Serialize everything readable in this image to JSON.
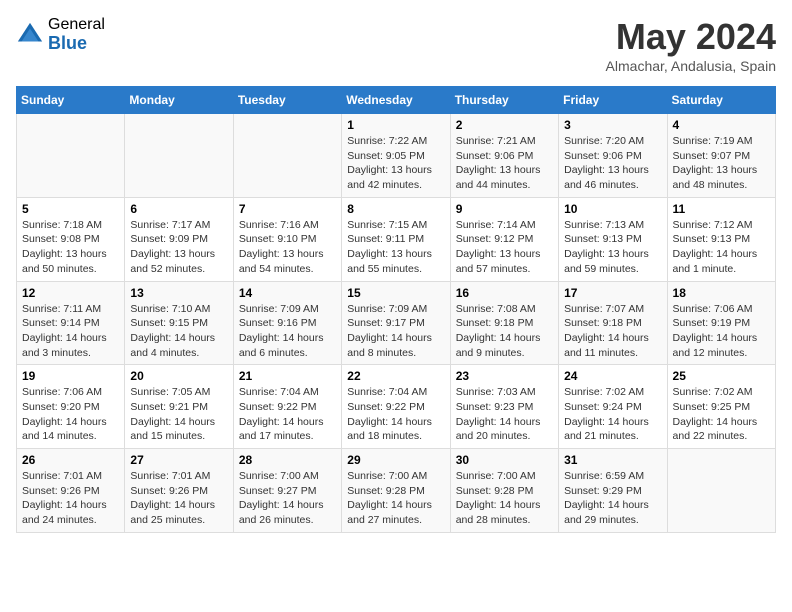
{
  "header": {
    "logo_general": "General",
    "logo_blue": "Blue",
    "month_title": "May 2024",
    "location": "Almachar, Andalusia, Spain"
  },
  "weekdays": [
    "Sunday",
    "Monday",
    "Tuesday",
    "Wednesday",
    "Thursday",
    "Friday",
    "Saturday"
  ],
  "weeks": [
    [
      {
        "day": "",
        "info": ""
      },
      {
        "day": "",
        "info": ""
      },
      {
        "day": "",
        "info": ""
      },
      {
        "day": "1",
        "info": "Sunrise: 7:22 AM\nSunset: 9:05 PM\nDaylight: 13 hours\nand 42 minutes."
      },
      {
        "day": "2",
        "info": "Sunrise: 7:21 AM\nSunset: 9:06 PM\nDaylight: 13 hours\nand 44 minutes."
      },
      {
        "day": "3",
        "info": "Sunrise: 7:20 AM\nSunset: 9:06 PM\nDaylight: 13 hours\nand 46 minutes."
      },
      {
        "day": "4",
        "info": "Sunrise: 7:19 AM\nSunset: 9:07 PM\nDaylight: 13 hours\nand 48 minutes."
      }
    ],
    [
      {
        "day": "5",
        "info": "Sunrise: 7:18 AM\nSunset: 9:08 PM\nDaylight: 13 hours\nand 50 minutes."
      },
      {
        "day": "6",
        "info": "Sunrise: 7:17 AM\nSunset: 9:09 PM\nDaylight: 13 hours\nand 52 minutes."
      },
      {
        "day": "7",
        "info": "Sunrise: 7:16 AM\nSunset: 9:10 PM\nDaylight: 13 hours\nand 54 minutes."
      },
      {
        "day": "8",
        "info": "Sunrise: 7:15 AM\nSunset: 9:11 PM\nDaylight: 13 hours\nand 55 minutes."
      },
      {
        "day": "9",
        "info": "Sunrise: 7:14 AM\nSunset: 9:12 PM\nDaylight: 13 hours\nand 57 minutes."
      },
      {
        "day": "10",
        "info": "Sunrise: 7:13 AM\nSunset: 9:13 PM\nDaylight: 13 hours\nand 59 minutes."
      },
      {
        "day": "11",
        "info": "Sunrise: 7:12 AM\nSunset: 9:13 PM\nDaylight: 14 hours\nand 1 minute."
      }
    ],
    [
      {
        "day": "12",
        "info": "Sunrise: 7:11 AM\nSunset: 9:14 PM\nDaylight: 14 hours\nand 3 minutes."
      },
      {
        "day": "13",
        "info": "Sunrise: 7:10 AM\nSunset: 9:15 PM\nDaylight: 14 hours\nand 4 minutes."
      },
      {
        "day": "14",
        "info": "Sunrise: 7:09 AM\nSunset: 9:16 PM\nDaylight: 14 hours\nand 6 minutes."
      },
      {
        "day": "15",
        "info": "Sunrise: 7:09 AM\nSunset: 9:17 PM\nDaylight: 14 hours\nand 8 minutes."
      },
      {
        "day": "16",
        "info": "Sunrise: 7:08 AM\nSunset: 9:18 PM\nDaylight: 14 hours\nand 9 minutes."
      },
      {
        "day": "17",
        "info": "Sunrise: 7:07 AM\nSunset: 9:18 PM\nDaylight: 14 hours\nand 11 minutes."
      },
      {
        "day": "18",
        "info": "Sunrise: 7:06 AM\nSunset: 9:19 PM\nDaylight: 14 hours\nand 12 minutes."
      }
    ],
    [
      {
        "day": "19",
        "info": "Sunrise: 7:06 AM\nSunset: 9:20 PM\nDaylight: 14 hours\nand 14 minutes."
      },
      {
        "day": "20",
        "info": "Sunrise: 7:05 AM\nSunset: 9:21 PM\nDaylight: 14 hours\nand 15 minutes."
      },
      {
        "day": "21",
        "info": "Sunrise: 7:04 AM\nSunset: 9:22 PM\nDaylight: 14 hours\nand 17 minutes."
      },
      {
        "day": "22",
        "info": "Sunrise: 7:04 AM\nSunset: 9:22 PM\nDaylight: 14 hours\nand 18 minutes."
      },
      {
        "day": "23",
        "info": "Sunrise: 7:03 AM\nSunset: 9:23 PM\nDaylight: 14 hours\nand 20 minutes."
      },
      {
        "day": "24",
        "info": "Sunrise: 7:02 AM\nSunset: 9:24 PM\nDaylight: 14 hours\nand 21 minutes."
      },
      {
        "day": "25",
        "info": "Sunrise: 7:02 AM\nSunset: 9:25 PM\nDaylight: 14 hours\nand 22 minutes."
      }
    ],
    [
      {
        "day": "26",
        "info": "Sunrise: 7:01 AM\nSunset: 9:26 PM\nDaylight: 14 hours\nand 24 minutes."
      },
      {
        "day": "27",
        "info": "Sunrise: 7:01 AM\nSunset: 9:26 PM\nDaylight: 14 hours\nand 25 minutes."
      },
      {
        "day": "28",
        "info": "Sunrise: 7:00 AM\nSunset: 9:27 PM\nDaylight: 14 hours\nand 26 minutes."
      },
      {
        "day": "29",
        "info": "Sunrise: 7:00 AM\nSunset: 9:28 PM\nDaylight: 14 hours\nand 27 minutes."
      },
      {
        "day": "30",
        "info": "Sunrise: 7:00 AM\nSunset: 9:28 PM\nDaylight: 14 hours\nand 28 minutes."
      },
      {
        "day": "31",
        "info": "Sunrise: 6:59 AM\nSunset: 9:29 PM\nDaylight: 14 hours\nand 29 minutes."
      },
      {
        "day": "",
        "info": ""
      }
    ]
  ]
}
